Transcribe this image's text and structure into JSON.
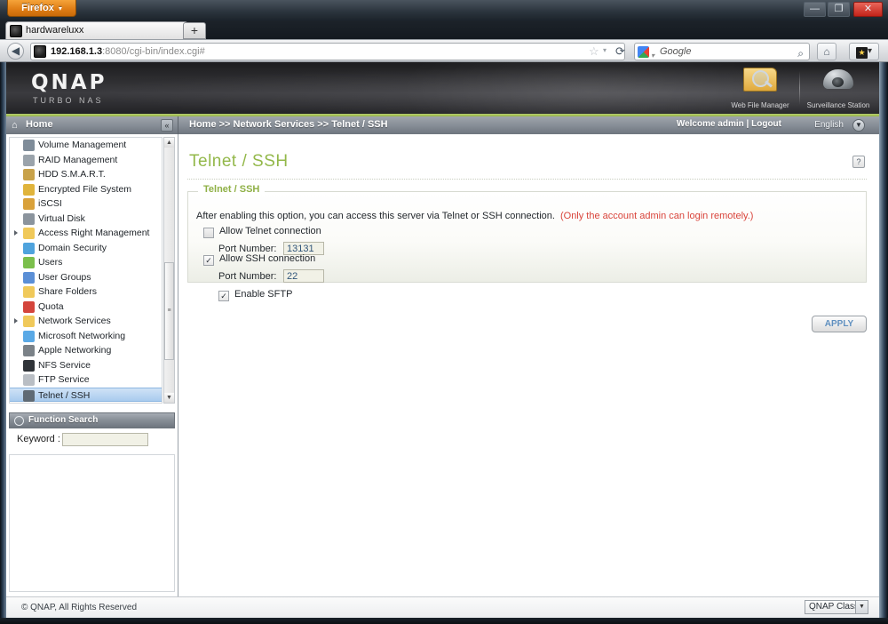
{
  "window": {
    "firefox_button": "Firefox",
    "firefox_caret": "▾",
    "minimize": "—",
    "maximize": "❐",
    "close": "✕"
  },
  "browser": {
    "tab_title": "hardwareluxx",
    "new_tab": "+",
    "back": "◀",
    "url_host": "192.168.1.3",
    "url_scheme": ":8080",
    "url_path": "/cgi-bin/index.cgi#",
    "star": "☆",
    "star_caret": "▾",
    "reload": "⟳",
    "search_placeholder": "Google",
    "search_caret": "▾",
    "search_magnifier": "⌕",
    "home": "⌂",
    "bookmarks": "▾"
  },
  "qnap_header": {
    "logo": "QNAP",
    "tagline": "TURBO NAS",
    "apps": [
      {
        "label": "Web File Manager"
      },
      {
        "label": "Surveillance Station"
      }
    ]
  },
  "appbar": {
    "home_label": "Home",
    "home_icon": "⌂",
    "collapse": "«",
    "breadcrumb": "Home >> Network Services >> Telnet / SSH",
    "welcome": "Welcome admin | Logout",
    "language": "English",
    "language_caret": "▼"
  },
  "sidebar": {
    "scrollbar": {
      "up": "▲",
      "down": "▼",
      "thumb": "≡"
    },
    "tree": [
      {
        "label": "Volume Management",
        "level": 1,
        "icon": "volume-icon",
        "icon_color": "#7f8c99",
        "selected": false,
        "twisty": false
      },
      {
        "label": "RAID Management",
        "level": 1,
        "icon": "raid-icon",
        "icon_color": "#9aa3ab",
        "selected": false,
        "twisty": false
      },
      {
        "label": "HDD S.M.A.R.T.",
        "level": 1,
        "icon": "hdd-smart-icon",
        "icon_color": "#c8a24a",
        "selected": false,
        "twisty": false
      },
      {
        "label": "Encrypted File System",
        "level": 1,
        "icon": "encrypted-fs-icon",
        "icon_color": "#e0b43c",
        "selected": false,
        "twisty": false
      },
      {
        "label": "iSCSI",
        "level": 1,
        "icon": "iscsi-icon",
        "icon_color": "#d9a13a",
        "selected": false,
        "twisty": false
      },
      {
        "label": "Virtual Disk",
        "level": 1,
        "icon": "virtual-disk-icon",
        "icon_color": "#8b949d",
        "selected": false,
        "twisty": false
      },
      {
        "label": "Access Right Management",
        "level": 0,
        "icon": "folder-icon",
        "icon_color": "#f0c95a",
        "selected": false,
        "twisty": true
      },
      {
        "label": "Domain Security",
        "level": 1,
        "icon": "domain-security-icon",
        "icon_color": "#4fa3dd",
        "selected": false,
        "twisty": false
      },
      {
        "label": "Users",
        "level": 1,
        "icon": "users-icon",
        "icon_color": "#7bbf4c",
        "selected": false,
        "twisty": false
      },
      {
        "label": "User Groups",
        "level": 1,
        "icon": "user-groups-icon",
        "icon_color": "#5b8fd6",
        "selected": false,
        "twisty": false
      },
      {
        "label": "Share Folders",
        "level": 1,
        "icon": "share-folders-icon",
        "icon_color": "#f0c95a",
        "selected": false,
        "twisty": false
      },
      {
        "label": "Quota",
        "level": 1,
        "icon": "quota-icon",
        "icon_color": "#d4453c",
        "selected": false,
        "twisty": false
      },
      {
        "label": "Network Services",
        "level": 0,
        "icon": "folder-icon",
        "icon_color": "#f0c95a",
        "selected": false,
        "twisty": true
      },
      {
        "label": "Microsoft Networking",
        "level": 1,
        "icon": "microsoft-networking-icon",
        "icon_color": "#5aa9e6",
        "selected": false,
        "twisty": false
      },
      {
        "label": "Apple Networking",
        "level": 1,
        "icon": "apple-networking-icon",
        "icon_color": "#7b8288",
        "selected": false,
        "twisty": false
      },
      {
        "label": "NFS Service",
        "level": 1,
        "icon": "nfs-service-icon",
        "icon_color": "#2f3338",
        "selected": false,
        "twisty": false
      },
      {
        "label": "FTP Service",
        "level": 1,
        "icon": "ftp-service-icon",
        "icon_color": "#b9bec4",
        "selected": false,
        "twisty": false
      },
      {
        "label": "Telnet / SSH",
        "level": 1,
        "icon": "telnet-ssh-icon",
        "icon_color": "#5f6a74",
        "selected": true,
        "twisty": false
      }
    ],
    "function_search": {
      "title": "Function Search",
      "keyword_label": "Keyword :",
      "keyword_value": "",
      "keyword_placeholder": ""
    }
  },
  "main": {
    "title": "Telnet / SSH",
    "help_icon": "?",
    "legend": "Telnet / SSH",
    "intro": "After enabling this option, you can access this server via Telnet or SSH connection.",
    "intro_note": "(Only the account admin can login remotely.)",
    "options": {
      "telnet_label": "Allow Telnet connection",
      "telnet_checked": false,
      "telnet_port_label": "Port Number:",
      "telnet_port_value": "13131",
      "ssh_label": "Allow SSH connection",
      "ssh_checked": true,
      "ssh_port_label": "Port Number:",
      "ssh_port_value": "22",
      "sftp_label": "Enable SFTP",
      "sftp_checked": true,
      "check_glyph": "✓"
    },
    "apply_label": "APPLY"
  },
  "footer": {
    "copyright": "© QNAP, All Rights Reserved",
    "theme": "QNAP Classic",
    "theme_caret": "▼"
  }
}
